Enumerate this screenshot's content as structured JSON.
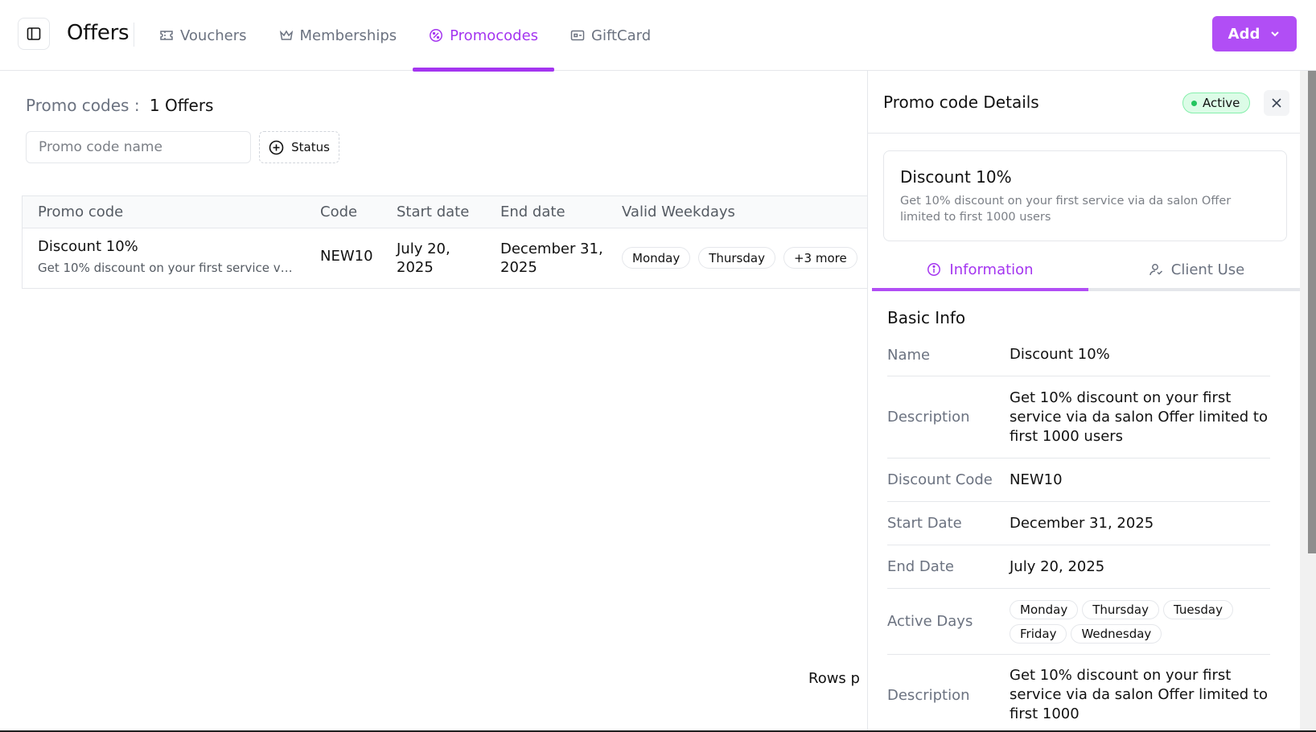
{
  "app": {
    "title": "Offers",
    "sidebar_toggle_icon": "sidebar-toggle-icon"
  },
  "nav": {
    "tabs": [
      {
        "label": "Vouchers",
        "icon": "ticket-icon",
        "active": false
      },
      {
        "label": "Memberships",
        "icon": "crown-icon",
        "active": false
      },
      {
        "label": "Promocodes",
        "icon": "badge-percent-icon",
        "active": true
      },
      {
        "label": "GiftCard",
        "icon": "gift-card-icon",
        "active": false
      }
    ],
    "add_label": "Add"
  },
  "main": {
    "count_label": "Promo codes :",
    "count_value": "1 Offers",
    "search_placeholder": "Promo code name",
    "status_filter_label": "Status",
    "table": {
      "headers": [
        "Promo code",
        "Code",
        "Start date",
        "End date",
        "Valid Weekdays"
      ],
      "rows": [
        {
          "name": "Discount 10%",
          "description": "Get 10% discount on your first service via da...",
          "code": "NEW10",
          "start_line1": "July 20,",
          "start_line2": "2025",
          "end_line1": "December 31,",
          "end_line2": "2025",
          "weekdays": [
            "Monday",
            "Thursday"
          ],
          "more": "+3 more"
        }
      ]
    },
    "rows_per_page_label": "Rows p"
  },
  "panel": {
    "title": "Promo code Details",
    "status": "Active",
    "card_title": "Discount 10%",
    "card_description": "Get 10% discount on your first service via da salon Offer limited to first 1000 users",
    "tabs": [
      {
        "label": "Information",
        "icon": "info-icon",
        "active": true
      },
      {
        "label": "Client Use",
        "icon": "client-use-icon",
        "active": false
      }
    ],
    "section_title": "Basic Info",
    "info": {
      "name_label": "Name",
      "name_value": "Discount 10%",
      "description_label": "Description",
      "description_value": "Get 10% discount on your first service via da salon Offer limited to first 1000 users",
      "discount_code_label": "Discount Code",
      "discount_code_value": "NEW10",
      "start_date_label": "Start Date",
      "start_date_value": "December 31, 2025",
      "end_date_label": "End Date",
      "end_date_value": "July 20, 2025",
      "active_days_label": "Active Days",
      "active_days": [
        "Monday",
        "Thursday",
        "Tuesday",
        "Friday",
        "Wednesday"
      ],
      "description2_label": "Description",
      "description2_value": "Get 10% discount on your first service via da salon Offer limited to first 1000"
    }
  },
  "colors": {
    "accent": "#a435f0",
    "button": "#b14ef5",
    "active_badge_bg": "#dcfce7",
    "active_dot": "#22c55e"
  }
}
